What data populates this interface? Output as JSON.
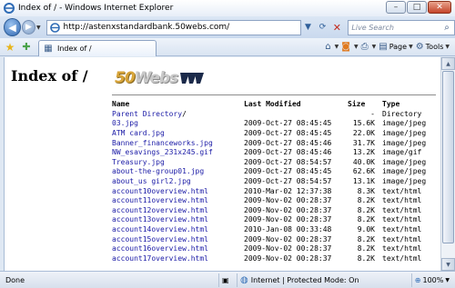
{
  "window": {
    "title": "Index of / - Windows Internet Explorer",
    "controls": [
      "–",
      "□",
      "✕"
    ]
  },
  "nav": {
    "back": "◀",
    "forward": "▶",
    "url": "http://astenxstandardbank.50webs.com/",
    "search_placeholder": "Live Search"
  },
  "commandbar": {
    "tab_label": "Index of /",
    "page_label": "Page",
    "tools_label": "Tools"
  },
  "page": {
    "heading": "Index of /",
    "logo_text_a": "50",
    "logo_text_b": "Webs",
    "columns": {
      "name": "Name",
      "modified": "Last Modified",
      "size": "Size",
      "type": "Type"
    },
    "rows": [
      {
        "name": "Parent Directory",
        "suffix": "/",
        "modified": "",
        "size": "-",
        "type": "Directory"
      },
      {
        "name": "03.jpg",
        "suffix": "",
        "modified": "2009-Oct-27 08:45:45",
        "size": "15.6K",
        "type": "image/jpeg"
      },
      {
        "name": "ATM card.jpg",
        "suffix": "",
        "modified": "2009-Oct-27 08:45:45",
        "size": "22.0K",
        "type": "image/jpeg"
      },
      {
        "name": "Banner_financeworks.jpg",
        "suffix": "",
        "modified": "2009-Oct-27 08:45:46",
        "size": "31.7K",
        "type": "image/jpeg"
      },
      {
        "name": "NW_esavings_231x245.gif",
        "suffix": "",
        "modified": "2009-Oct-27 08:45:46",
        "size": "13.2K",
        "type": "image/gif"
      },
      {
        "name": "Treasury.jpg",
        "suffix": "",
        "modified": "2009-Oct-27 08:54:57",
        "size": "40.0K",
        "type": "image/jpeg"
      },
      {
        "name": "about-the-group01.jpg",
        "suffix": "",
        "modified": "2009-Oct-27 08:45:45",
        "size": "62.6K",
        "type": "image/jpeg"
      },
      {
        "name": "about_us girl2.jpg",
        "suffix": "",
        "modified": "2009-Oct-27 08:54:57",
        "size": "13.1K",
        "type": "image/jpeg"
      },
      {
        "name": "account10overview.html",
        "suffix": "",
        "modified": "2010-Mar-02 12:37:38",
        "size": "8.3K",
        "type": "text/html"
      },
      {
        "name": "account11overview.html",
        "suffix": "",
        "modified": "2009-Nov-02 00:28:37",
        "size": "8.2K",
        "type": "text/html"
      },
      {
        "name": "account12overview.html",
        "suffix": "",
        "modified": "2009-Nov-02 00:28:37",
        "size": "8.2K",
        "type": "text/html"
      },
      {
        "name": "account13overview.html",
        "suffix": "",
        "modified": "2009-Nov-02 00:28:37",
        "size": "8.2K",
        "type": "text/html"
      },
      {
        "name": "account14overview.html",
        "suffix": "",
        "modified": "2010-Jan-08 00:33:48",
        "size": "9.0K",
        "type": "text/html"
      },
      {
        "name": "account15overview.html",
        "suffix": "",
        "modified": "2009-Nov-02 00:28:37",
        "size": "8.2K",
        "type": "text/html"
      },
      {
        "name": "account16overview.html",
        "suffix": "",
        "modified": "2009-Nov-02 00:28:37",
        "size": "8.2K",
        "type": "text/html"
      },
      {
        "name": "account17overview.html",
        "suffix": "",
        "modified": "2009-Nov-02 00:28:37",
        "size": "8.2K",
        "type": "text/html"
      }
    ]
  },
  "status": {
    "text": "Done",
    "zone": "Internet | Protected Mode: On",
    "zoom": "100%"
  },
  "colors": {
    "link": "#1a1aa6",
    "chrome": "#dfe8f3"
  }
}
